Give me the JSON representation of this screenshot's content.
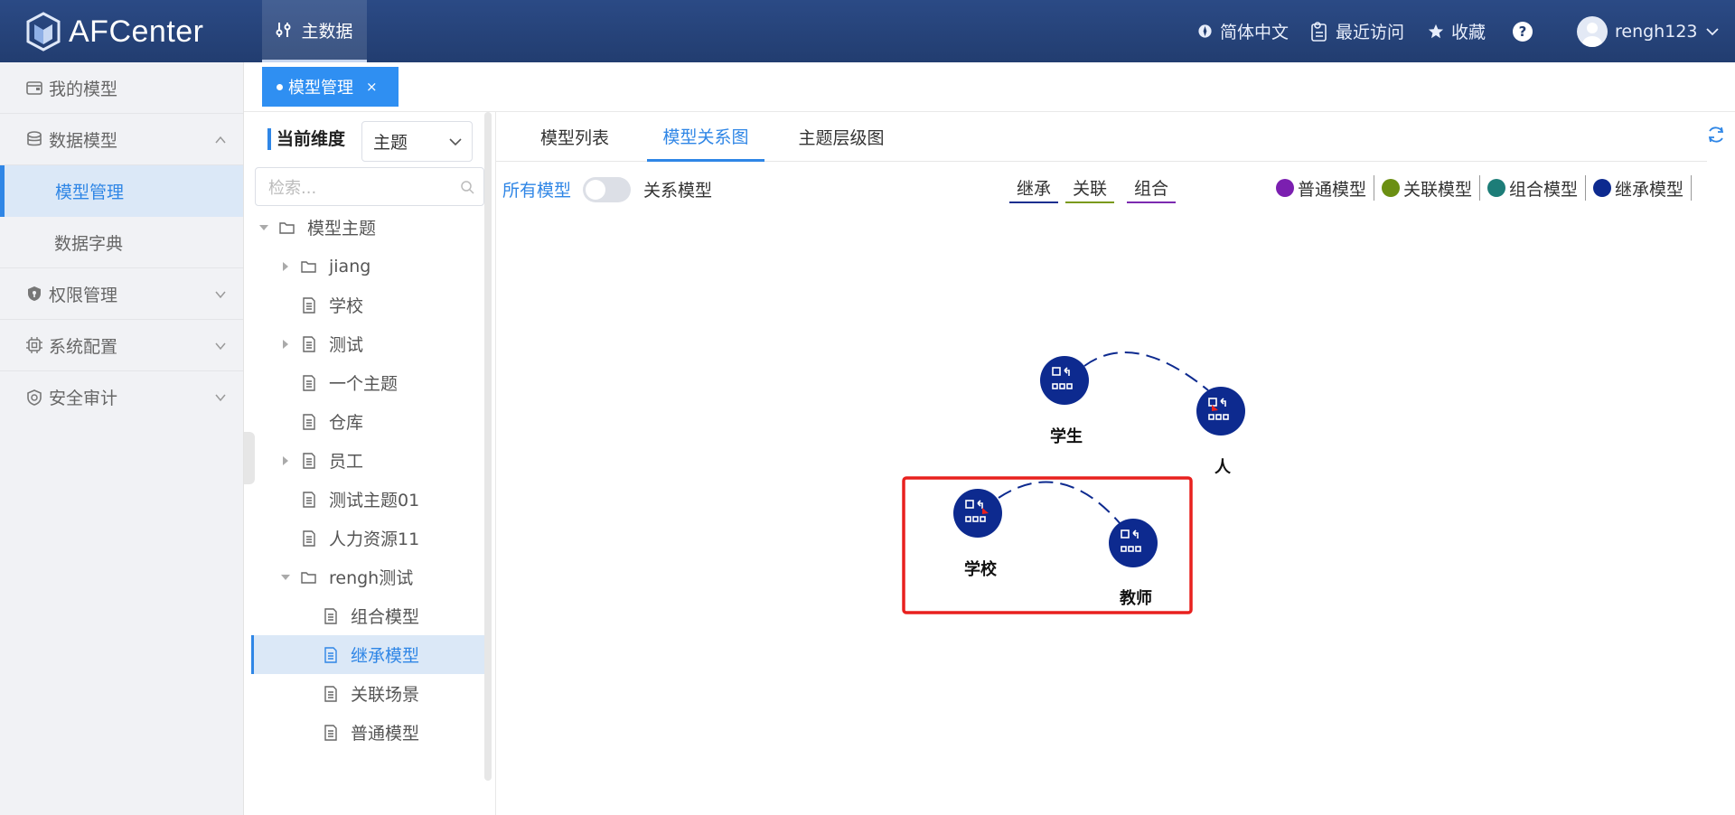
{
  "brand": {
    "name": "AFCenter"
  },
  "topnav": {
    "label": "主数据"
  },
  "header": {
    "language": "简体中文",
    "recent": "最近访问",
    "favorites": "收藏",
    "help": "?",
    "username": "rengh123"
  },
  "sidebar": {
    "items": [
      {
        "label": "我的模型",
        "icon": "wallet-icon"
      },
      {
        "label": "数据模型",
        "icon": "database-icon",
        "expanded": true
      },
      {
        "label": "模型管理",
        "active": true
      },
      {
        "label": "数据字典"
      },
      {
        "label": "权限管理",
        "icon": "shield-icon"
      },
      {
        "label": "系统配置",
        "icon": "chip-icon"
      },
      {
        "label": "安全审计",
        "icon": "shield-check-icon"
      }
    ]
  },
  "page_tab": {
    "label": "模型管理",
    "close": "×"
  },
  "tree": {
    "dimension_label": "当前维度",
    "dimension_value": "主题",
    "search_placeholder": "检索...",
    "nodes": [
      {
        "label": "模型主题",
        "type": "folder",
        "expanded": true
      },
      {
        "label": "jiang",
        "type": "folder"
      },
      {
        "label": "学校",
        "type": "doc"
      },
      {
        "label": "测试",
        "type": "doc"
      },
      {
        "label": "一个主题",
        "type": "doc"
      },
      {
        "label": "仓库",
        "type": "doc"
      },
      {
        "label": "员工",
        "type": "doc"
      },
      {
        "label": "测试主题01",
        "type": "doc"
      },
      {
        "label": "人力资源11",
        "type": "doc"
      },
      {
        "label": "rengh测试",
        "type": "folder",
        "expanded": true
      },
      {
        "label": "组合模型",
        "type": "doc"
      },
      {
        "label": "继承模型",
        "type": "doc",
        "selected": true
      },
      {
        "label": "关联场景",
        "type": "doc"
      },
      {
        "label": "普通模型",
        "type": "doc"
      }
    ]
  },
  "main": {
    "tabs": [
      "模型列表",
      "模型关系图",
      "主题层级图"
    ],
    "active_tab": "模型关系图",
    "all_models": "所有模型",
    "relation_models": "关系模型",
    "relation_legend": [
      {
        "label": "继承",
        "color": "#1b2f8f"
      },
      {
        "label": "关联",
        "color": "#7a9a1a"
      },
      {
        "label": "组合",
        "color": "#7b2ab0"
      }
    ],
    "type_legend": [
      {
        "label": "普通模型",
        "color": "#7b1fb0"
      },
      {
        "label": "关联模型",
        "color": "#6b8f12"
      },
      {
        "label": "组合模型",
        "color": "#1d7d78"
      },
      {
        "label": "继承模型",
        "color": "#0d2a8f"
      }
    ]
  },
  "graph": {
    "node_color": "#0d2a8f",
    "highlight_color": "#e8201e",
    "nodes": [
      "学生",
      "人",
      "学校",
      "教师"
    ],
    "edges": [
      {
        "from": "学生",
        "to": "人",
        "type": "继承"
      },
      {
        "from": "学校",
        "to": "教师",
        "type": "继承"
      }
    ]
  }
}
